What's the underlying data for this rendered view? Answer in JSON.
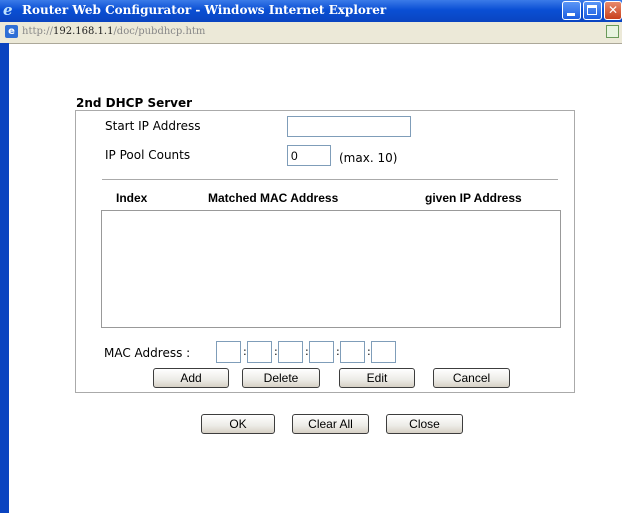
{
  "window": {
    "title": "Router Web Configurator - Windows Internet Explorer",
    "url_prefix": "http://",
    "url_host": "192.168.1.1",
    "url_path": "/doc/pubdhcp.htm"
  },
  "form": {
    "section_title": "2nd DHCP Server",
    "start_ip_label": "Start IP Address",
    "start_ip_value": "",
    "pool_counts_label": "IP Pool Counts",
    "pool_counts_value": "0",
    "pool_counts_hint": "(max. 10)"
  },
  "table": {
    "columns": [
      "Index",
      "Matched MAC Address",
      "given IP Address"
    ],
    "rows": []
  },
  "mac": {
    "label": "MAC Address :",
    "separator": ":",
    "octets": [
      "",
      "",
      "",
      "",
      "",
      ""
    ]
  },
  "entry_buttons": {
    "add": "Add",
    "delete": "Delete",
    "edit": "Edit",
    "cancel": "Cancel"
  },
  "dialog_buttons": {
    "ok": "OK",
    "clear_all": "Clear All",
    "close": "Close"
  },
  "colors": {
    "titlebar": "#0a4fd4",
    "border": "#aaaaaa"
  }
}
